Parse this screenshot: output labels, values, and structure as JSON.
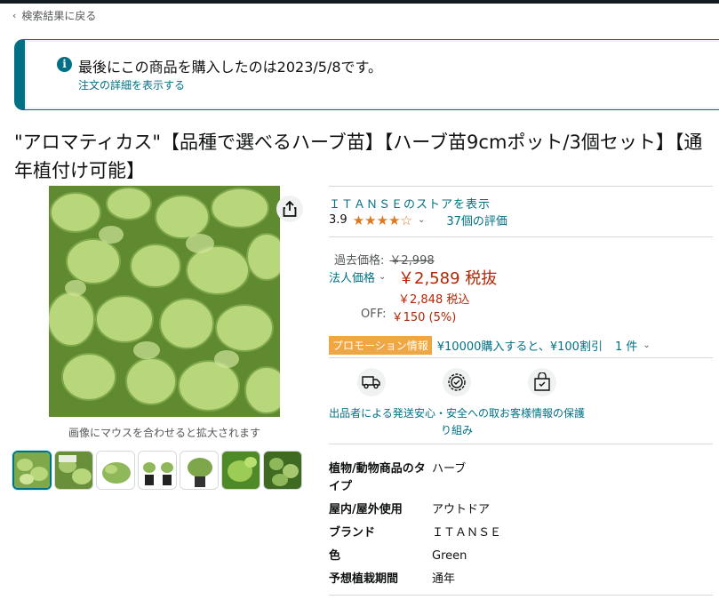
{
  "nav": {
    "back_label": "検索結果に戻る"
  },
  "alert": {
    "message": "最後にこの商品を購入したのは2023/5/8です。",
    "link": "注文の詳細を表示する"
  },
  "product": {
    "title": "\"アロマティカス\"【品種で選べるハーブ苗】【ハーブ苗9cmポット/3個セット】【通年植付け可能】",
    "hover_hint": "画像にマウスを合わせると拡大されます",
    "thumbnail_count": 7
  },
  "store": {
    "label": "ＩＴＡＮＳＥのストアを表示"
  },
  "rating": {
    "value": "3.9",
    "stars": "★★★★☆",
    "count_label": "37個の評価",
    "stars_fraction": 0.78
  },
  "pricing": {
    "past_label": "過去価格:",
    "past_value": "￥2,998",
    "business_label": "法人価格",
    "price": "￥2,589 税抜",
    "tax_included": "￥2,848 税込",
    "off_label": "OFF:",
    "off_value": "￥150 (5%)"
  },
  "promotion": {
    "badge": "プロモーション情報",
    "text": "¥10000購入すると、¥100割引",
    "count": "1 件"
  },
  "features": [
    {
      "icon": "truck-icon",
      "label": "出品者による発送"
    },
    {
      "icon": "shield-check-icon",
      "label": "安心・安全への取り組み"
    },
    {
      "icon": "lock-bag-icon",
      "label": "お客様情報の保護"
    }
  ],
  "specs": [
    {
      "key": "植物/動物商品のタイプ",
      "value": "ハーブ"
    },
    {
      "key": "屋内/屋外使用",
      "value": "アウトドア"
    },
    {
      "key": "ブランド",
      "value": "ＩＴＡＮＳＥ"
    },
    {
      "key": "色",
      "value": "Green"
    },
    {
      "key": "予想植栽期間",
      "value": "通年"
    }
  ],
  "colors": {
    "link": "#007185",
    "price": "#b12704",
    "star": "#de7921",
    "promo_badge": "#f0a742"
  }
}
